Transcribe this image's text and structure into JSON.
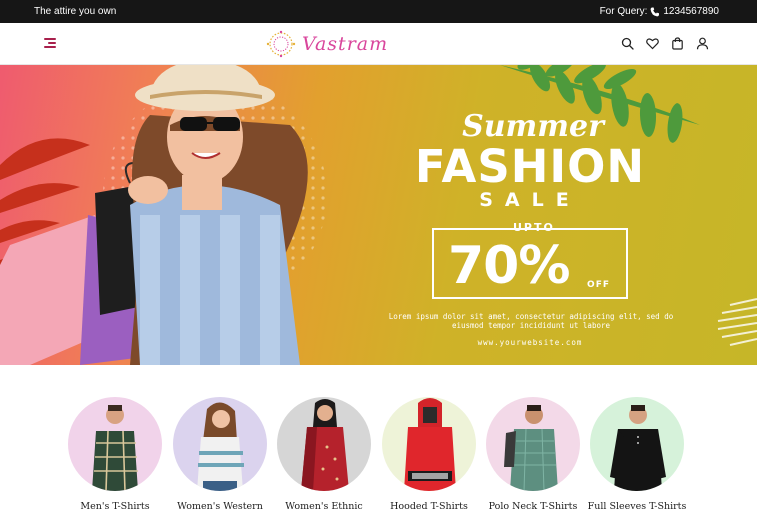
{
  "topbar": {
    "tagline": "The attire you own",
    "query_label": "For Query:",
    "phone_icon": "phone-icon",
    "phone": "1234567890"
  },
  "header": {
    "logo_text": "Vastram",
    "icons": [
      "menu-icon",
      "search-icon",
      "heart-icon",
      "cart-icon",
      "user-icon"
    ],
    "accent": "#a8204c",
    "logo_color": "#d9469c"
  },
  "hero": {
    "title_line1": "Summer",
    "title_line2": "FASHION",
    "title_line3": "SALE",
    "offer_prefix": "UPTO",
    "offer_value": "70%",
    "offer_suffix": "OFF",
    "body": "Lorem ipsum dolor sit amet, consectetur adipiscing elit, sed do eiusmod tempor incididunt ut labore",
    "website": "www.yourwebsite.com",
    "colors": {
      "left": "#ef5b6f",
      "right": "#c6b628",
      "text": "#ffffff"
    }
  },
  "categories": [
    {
      "label": "Men's T-Shirts",
      "bg": "#f1d3ea"
    },
    {
      "label": "Women's Western",
      "bg": "#dbd3ee"
    },
    {
      "label": "Women's Ethnic",
      "bg": "#d6d6d6"
    },
    {
      "label": "Hooded T-Shirts",
      "bg": "#eef3d8"
    },
    {
      "label": "Polo Neck T-Shirts",
      "bg": "#f3d9e8"
    },
    {
      "label": "Full Sleeves T-Shirts",
      "bg": "#d6f2da"
    }
  ]
}
